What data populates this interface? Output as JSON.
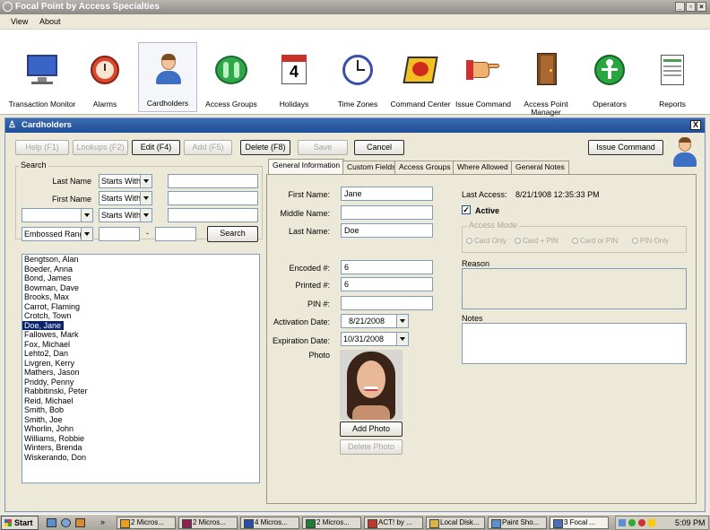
{
  "app": {
    "title": "Focal Point by Access Specialties"
  },
  "menu": [
    "View",
    "About"
  ],
  "toolbar": [
    {
      "label": "Transaction Monitor",
      "icon": "monitor-icon"
    },
    {
      "label": "Alarms",
      "icon": "alarm-clock-icon"
    },
    {
      "label": "Cardholders",
      "icon": "person-icon"
    },
    {
      "label": "Access Groups",
      "icon": "group-icon"
    },
    {
      "label": "Holidays",
      "icon": "calendar-icon",
      "day": "4"
    },
    {
      "label": "Time Zones",
      "icon": "clock-icon"
    },
    {
      "label": "Command Center",
      "icon": "command-icon"
    },
    {
      "label": "Issue Command",
      "icon": "pointing-hand-icon"
    },
    {
      "label": "Access Point Manager",
      "icon": "door-icon"
    },
    {
      "label": "Operators",
      "icon": "operator-icon"
    },
    {
      "label": "Reports",
      "icon": "report-icon"
    }
  ],
  "window": {
    "title": "Cardholders",
    "close": "X"
  },
  "buttons": {
    "help": "Help (F1)",
    "lookups": "Lookups (F2)",
    "edit": "Edit (F4)",
    "add": "Add (F5)",
    "delete": "Delete (F8)",
    "save": "Save",
    "cancel": "Cancel",
    "issue": "Issue Command"
  },
  "search": {
    "title": "Search",
    "last_name_label": "Last Name",
    "first_name_label": "First Name",
    "starts_with": "Starts With",
    "embossed": "Embossed Rang",
    "dash": "-",
    "search_button": "Search"
  },
  "cardholders": [
    "Bengtson, Alan",
    "Boeder, Anna",
    "Bond, James",
    "Bowman, Dave",
    "Brooks, Max",
    "Carrot, Flaming",
    "Crotch, Town",
    "Doe, Jane",
    "Fallowes, Mark",
    "Fox, Michael",
    "Lehto2, Dan",
    "Livgren, Kerry",
    "Mathers, Jason",
    "Priddy, Penny",
    "Rabbitinski, Peter",
    "Reid, Michael",
    "Smith, Bob",
    "Smith, Joe",
    "Whorlin, John",
    "Williams, Robbie",
    "Winters, Brenda",
    "Wiskerando, Don"
  ],
  "selected_index": 7,
  "tabs": [
    "General Information",
    "Custom Fields",
    "Access Groups",
    "Where Allowed",
    "General Notes"
  ],
  "form": {
    "first_name_label": "First Name:",
    "first_name": "Jane",
    "middle_name_label": "Middle Name:",
    "middle_name": "",
    "last_name_label": "Last Name:",
    "last_name": "Doe",
    "encoded_label": "Encoded #:",
    "encoded": "6",
    "printed_label": "Printed #:",
    "printed": "6",
    "pin_label": "PIN #:",
    "pin": "",
    "activation_label": "Activation Date:",
    "activation": "8/21/2008",
    "expiration_label": "Expiration Date:",
    "expiration": "10/31/2008",
    "photo_label": "Photo",
    "add_photo": "Add Photo",
    "delete_photo": "Delete Photo",
    "last_access_label": "Last Access:",
    "last_access": "8/21/1908 12:35:33 PM",
    "active_label": "Active",
    "access_mode_label": "Access Mode",
    "modes": [
      "Card Only",
      "Card + PIN",
      "Card or PIN",
      "PIN Only"
    ],
    "reason_label": "Reason",
    "notes_label": "Notes"
  },
  "taskbar": {
    "start": "Start",
    "items": [
      {
        "label": "2 Micros...",
        "color": "#e8a020"
      },
      {
        "label": "2 Micros...",
        "color": "#8b2252"
      },
      {
        "label": "4 Micros...",
        "color": "#2b4fa8"
      },
      {
        "label": "2 Micros...",
        "color": "#1e7b3a"
      },
      {
        "label": "ACT! by ...",
        "color": "#c0392b"
      },
      {
        "label": "Local Disk...",
        "color": "#d9b34a"
      },
      {
        "label": "Paint Sho...",
        "color": "#5a8fd0"
      },
      {
        "label": "3 Focal ...",
        "color": "#4a70b8"
      }
    ],
    "time": "5:09 PM"
  }
}
